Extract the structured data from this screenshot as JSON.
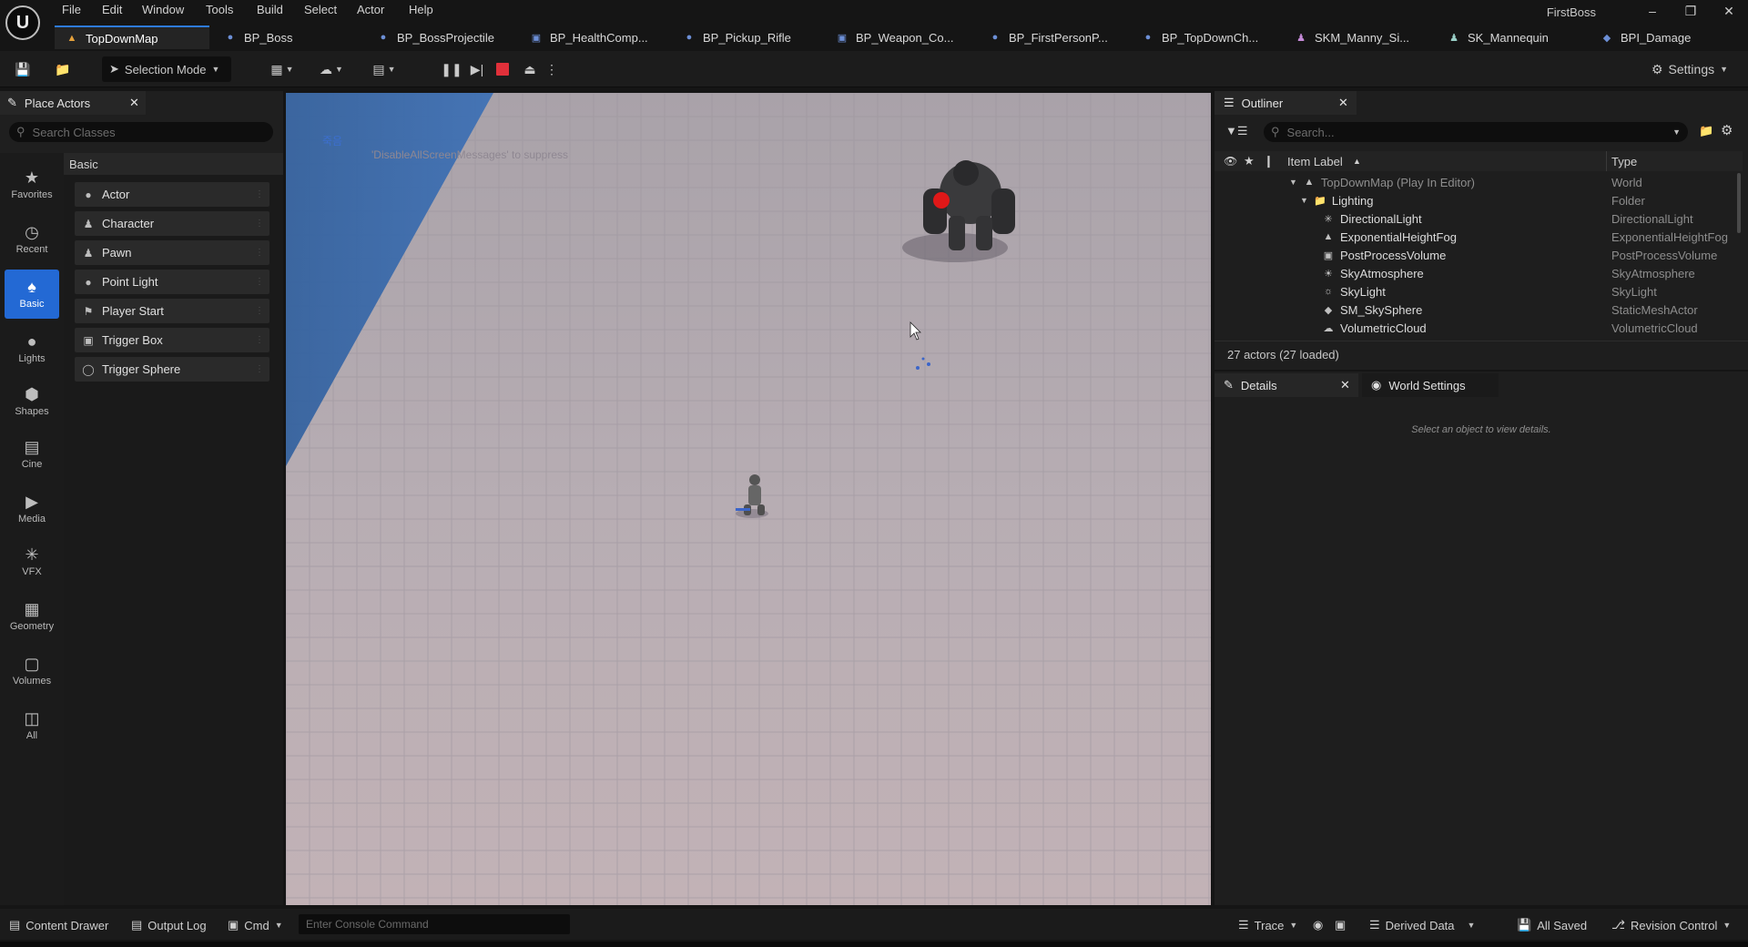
{
  "menu": [
    "File",
    "Edit",
    "Window",
    "Tools",
    "Build",
    "Select",
    "Actor",
    "Help"
  ],
  "project_name": "FirstBoss",
  "tabs": [
    {
      "label": "TopDownMap",
      "icon": "map-icon"
    },
    {
      "label": "BP_Boss",
      "icon": "blueprint-icon"
    },
    {
      "label": "BP_BossProjectile",
      "icon": "blueprint-icon"
    },
    {
      "label": "BP_HealthComp...",
      "icon": "component-icon"
    },
    {
      "label": "BP_Pickup_Rifle",
      "icon": "blueprint-icon"
    },
    {
      "label": "BP_Weapon_Co...",
      "icon": "component-icon"
    },
    {
      "label": "BP_FirstPersonP...",
      "icon": "blueprint-icon"
    },
    {
      "label": "BP_TopDownCh...",
      "icon": "blueprint-icon"
    },
    {
      "label": "SKM_Manny_Si...",
      "icon": "skeletal-mesh-icon"
    },
    {
      "label": "SK_Mannequin",
      "icon": "skeleton-icon"
    },
    {
      "label": "BPI_Damage",
      "icon": "interface-icon"
    }
  ],
  "toolbar": {
    "selection_mode": "Selection Mode",
    "settings": "Settings"
  },
  "place_actors": {
    "tab_title": "Place Actors",
    "search_placeholder": "Search Classes",
    "categories": [
      {
        "label": "Favorites",
        "icon": "star-icon"
      },
      {
        "label": "Recent",
        "icon": "clock-icon"
      },
      {
        "label": "Basic",
        "icon": "basic-icon"
      },
      {
        "label": "Lights",
        "icon": "light-icon"
      },
      {
        "label": "Shapes",
        "icon": "shapes-icon"
      },
      {
        "label": "Cine",
        "icon": "cine-icon"
      },
      {
        "label": "Media",
        "icon": "media-icon"
      },
      {
        "label": "VFX",
        "icon": "vfx-icon"
      },
      {
        "label": "Geometry",
        "icon": "geometry-icon"
      },
      {
        "label": "Volumes",
        "icon": "volumes-icon"
      },
      {
        "label": "All",
        "icon": "all-icon"
      }
    ],
    "section": "Basic",
    "items": [
      "Actor",
      "Character",
      "Pawn",
      "Point Light",
      "Player Start",
      "Trigger Box",
      "Trigger Sphere"
    ]
  },
  "viewport": {
    "message": "'DisableAllScreenMessages' to suppress",
    "korean_text": "죽음"
  },
  "outliner": {
    "tab_title": "Outliner",
    "search_placeholder": "Search...",
    "col_label": "Item Label",
    "col_type": "Type",
    "rows": [
      {
        "label": "TopDownMap (Play In Editor)",
        "type": "World"
      },
      {
        "label": "Lighting",
        "type": "Folder"
      },
      {
        "label": "DirectionalLight",
        "type": "DirectionalLight"
      },
      {
        "label": "ExponentialHeightFog",
        "type": "ExponentialHeightFog"
      },
      {
        "label": "PostProcessVolume",
        "type": "PostProcessVolume"
      },
      {
        "label": "SkyAtmosphere",
        "type": "SkyAtmosphere"
      },
      {
        "label": "SkyLight",
        "type": "SkyLight"
      },
      {
        "label": "SM_SkySphere",
        "type": "StaticMeshActor"
      },
      {
        "label": "VolumetricCloud",
        "type": "VolumetricCloud"
      }
    ],
    "count": "27 actors (27 loaded)"
  },
  "details": {
    "tab_title": "Details",
    "world_settings": "World Settings",
    "empty_message": "Select an object to view details."
  },
  "statusbar": {
    "content_drawer": "Content Drawer",
    "output_log": "Output Log",
    "cmd": "Cmd",
    "console_placeholder": "Enter Console Command",
    "trace": "Trace",
    "derived_data": "Derived Data",
    "all_saved": "All Saved",
    "revision_control": "Revision Control"
  },
  "colors": {
    "accent": "#2369d4",
    "stop": "#e0303a",
    "boss_marker": "#e01818"
  }
}
